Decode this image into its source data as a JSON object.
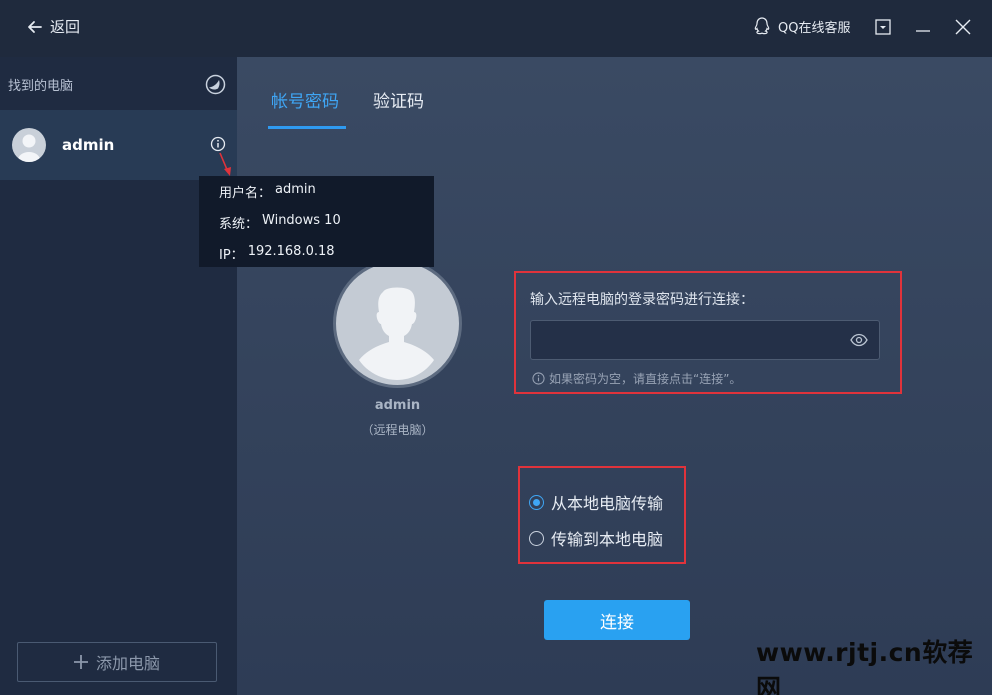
{
  "titlebar": {
    "back_label": "返回",
    "qq_service_label": "QQ在线客服"
  },
  "sidebar": {
    "title": "找到的电脑",
    "computer_name": "admin",
    "add_label": "添加电脑"
  },
  "tooltip": {
    "username_label": "用户名：",
    "username_value": "admin",
    "system_label": "系统：",
    "system_value": "Windows 10",
    "ip_label": "IP：",
    "ip_value": "192.168.0.18"
  },
  "tabs": [
    {
      "label": "帐号密码",
      "active": true
    },
    {
      "label": "验证码",
      "active": false
    }
  ],
  "remote": {
    "name": "admin",
    "subtitle": "（远程电脑）"
  },
  "password": {
    "label": "输入远程电脑的登录密码进行连接：",
    "value": "",
    "hint": "如果密码为空，请直接点击“连接”。"
  },
  "direction": {
    "options": [
      {
        "label": "从本地电脑传输",
        "checked": true
      },
      {
        "label": "传输到本地电脑",
        "checked": false
      }
    ]
  },
  "connect_label": "连接",
  "watermark": "www.rjtj.cn软荐网",
  "colors": {
    "accent": "#29a1f1",
    "highlight_border": "#e0333b",
    "sidebar_bg": "#1f2b41",
    "main_bg": "#3a4a63"
  }
}
